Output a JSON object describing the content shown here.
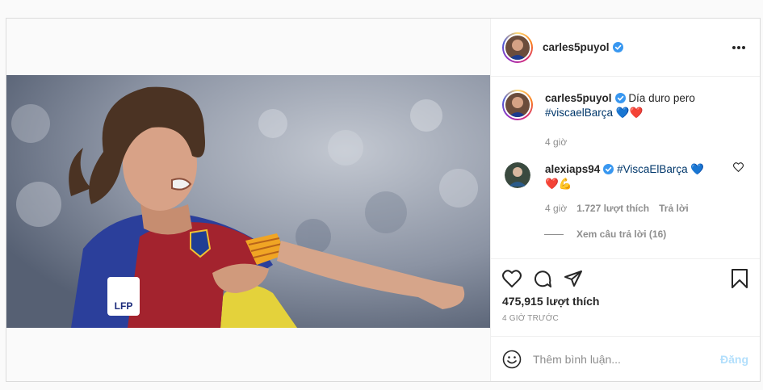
{
  "post": {
    "author": "carles5puyol",
    "likes": "475,915 lượt thích",
    "posted": "4 GIỜ TRƯỚC"
  },
  "caption": {
    "user": "carles5puyol",
    "text": "Día duro pero",
    "hashtag": "#viscaelBarça",
    "emojis": "💙❤️",
    "time": "4 giờ"
  },
  "comments": [
    {
      "user": "alexiaps94",
      "hashtag": "#ViscaElBarça",
      "emojis": "💙",
      "emojis2": "❤️💪",
      "time": "4 giờ",
      "likes": "1.727 lượt thích",
      "reply": "Trả lời",
      "view_replies": "Xem câu trả lời (16)"
    }
  ],
  "add_comment": {
    "placeholder": "Thêm bình luận...",
    "post_label": "Đăng"
  },
  "icons": {
    "verified": "verified-badge-icon",
    "more": "more-options-icon",
    "like": "heart-icon",
    "comment": "comment-icon",
    "share": "share-icon",
    "save": "bookmark-icon",
    "emoji": "emoji-icon"
  },
  "colors": {
    "verified": "#3897f0",
    "hashtag": "#00376b",
    "post_button": "#b2dffc"
  }
}
